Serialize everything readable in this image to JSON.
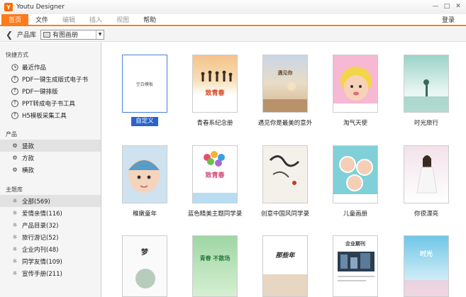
{
  "window": {
    "title": "Youtu Designer",
    "app_icon": "youtu-logo-icon"
  },
  "menu": {
    "items": [
      "首页",
      "文件",
      "编辑",
      "插入",
      "视图",
      "帮助"
    ],
    "login": "登录"
  },
  "toolbar": {
    "library_label": "产品库",
    "select_value": "有图画册"
  },
  "sidebar": {
    "shortcuts_title": "快捷方式",
    "shortcuts": [
      "最近作品",
      "PDF一键生成版式电子书",
      "PDF一键排版",
      "PPT转成电子书工具",
      "H5模板采集工具"
    ],
    "products_title": "产品",
    "products": [
      "竖款",
      "方款",
      "横款"
    ],
    "themes_title": "主题库",
    "themes": [
      "全部(569)",
      "爱情亲情(116)",
      "产品目录(32)",
      "旅行游记(52)",
      "企业内刊(48)",
      "同学友情(109)",
      "宣传手册(211)"
    ]
  },
  "grid": {
    "row1": [
      {
        "label": "自定义",
        "cover_text": "空白模板"
      },
      {
        "label": "青春系纪念册",
        "cover_text": "致青春"
      },
      {
        "label": "遇见你是最美的意外",
        "cover_text": "遇见你"
      },
      {
        "label": "淘气天使",
        "cover_text": ""
      },
      {
        "label": "时光旅行",
        "cover_text": ""
      }
    ],
    "row2": [
      {
        "label": "稚嫩童年",
        "cover_text": ""
      },
      {
        "label": "蓝色精美主题同学录",
        "cover_text": "致青春"
      },
      {
        "label": "创意中国风同学录",
        "cover_text": ""
      },
      {
        "label": "儿童画册",
        "cover_text": ""
      },
      {
        "label": "你很漂亮",
        "cover_text": ""
      }
    ],
    "row3": [
      {
        "label": "",
        "cover_text": "梦"
      },
      {
        "label": "",
        "cover_text": "青春 不散场"
      },
      {
        "label": "",
        "cover_text": "那些年"
      },
      {
        "label": "",
        "cover_text": "企业期刊"
      },
      {
        "label": "",
        "cover_text": "时光"
      }
    ]
  },
  "colors": {
    "accent": "#ff7a1a",
    "selection": "#2b63c9"
  }
}
